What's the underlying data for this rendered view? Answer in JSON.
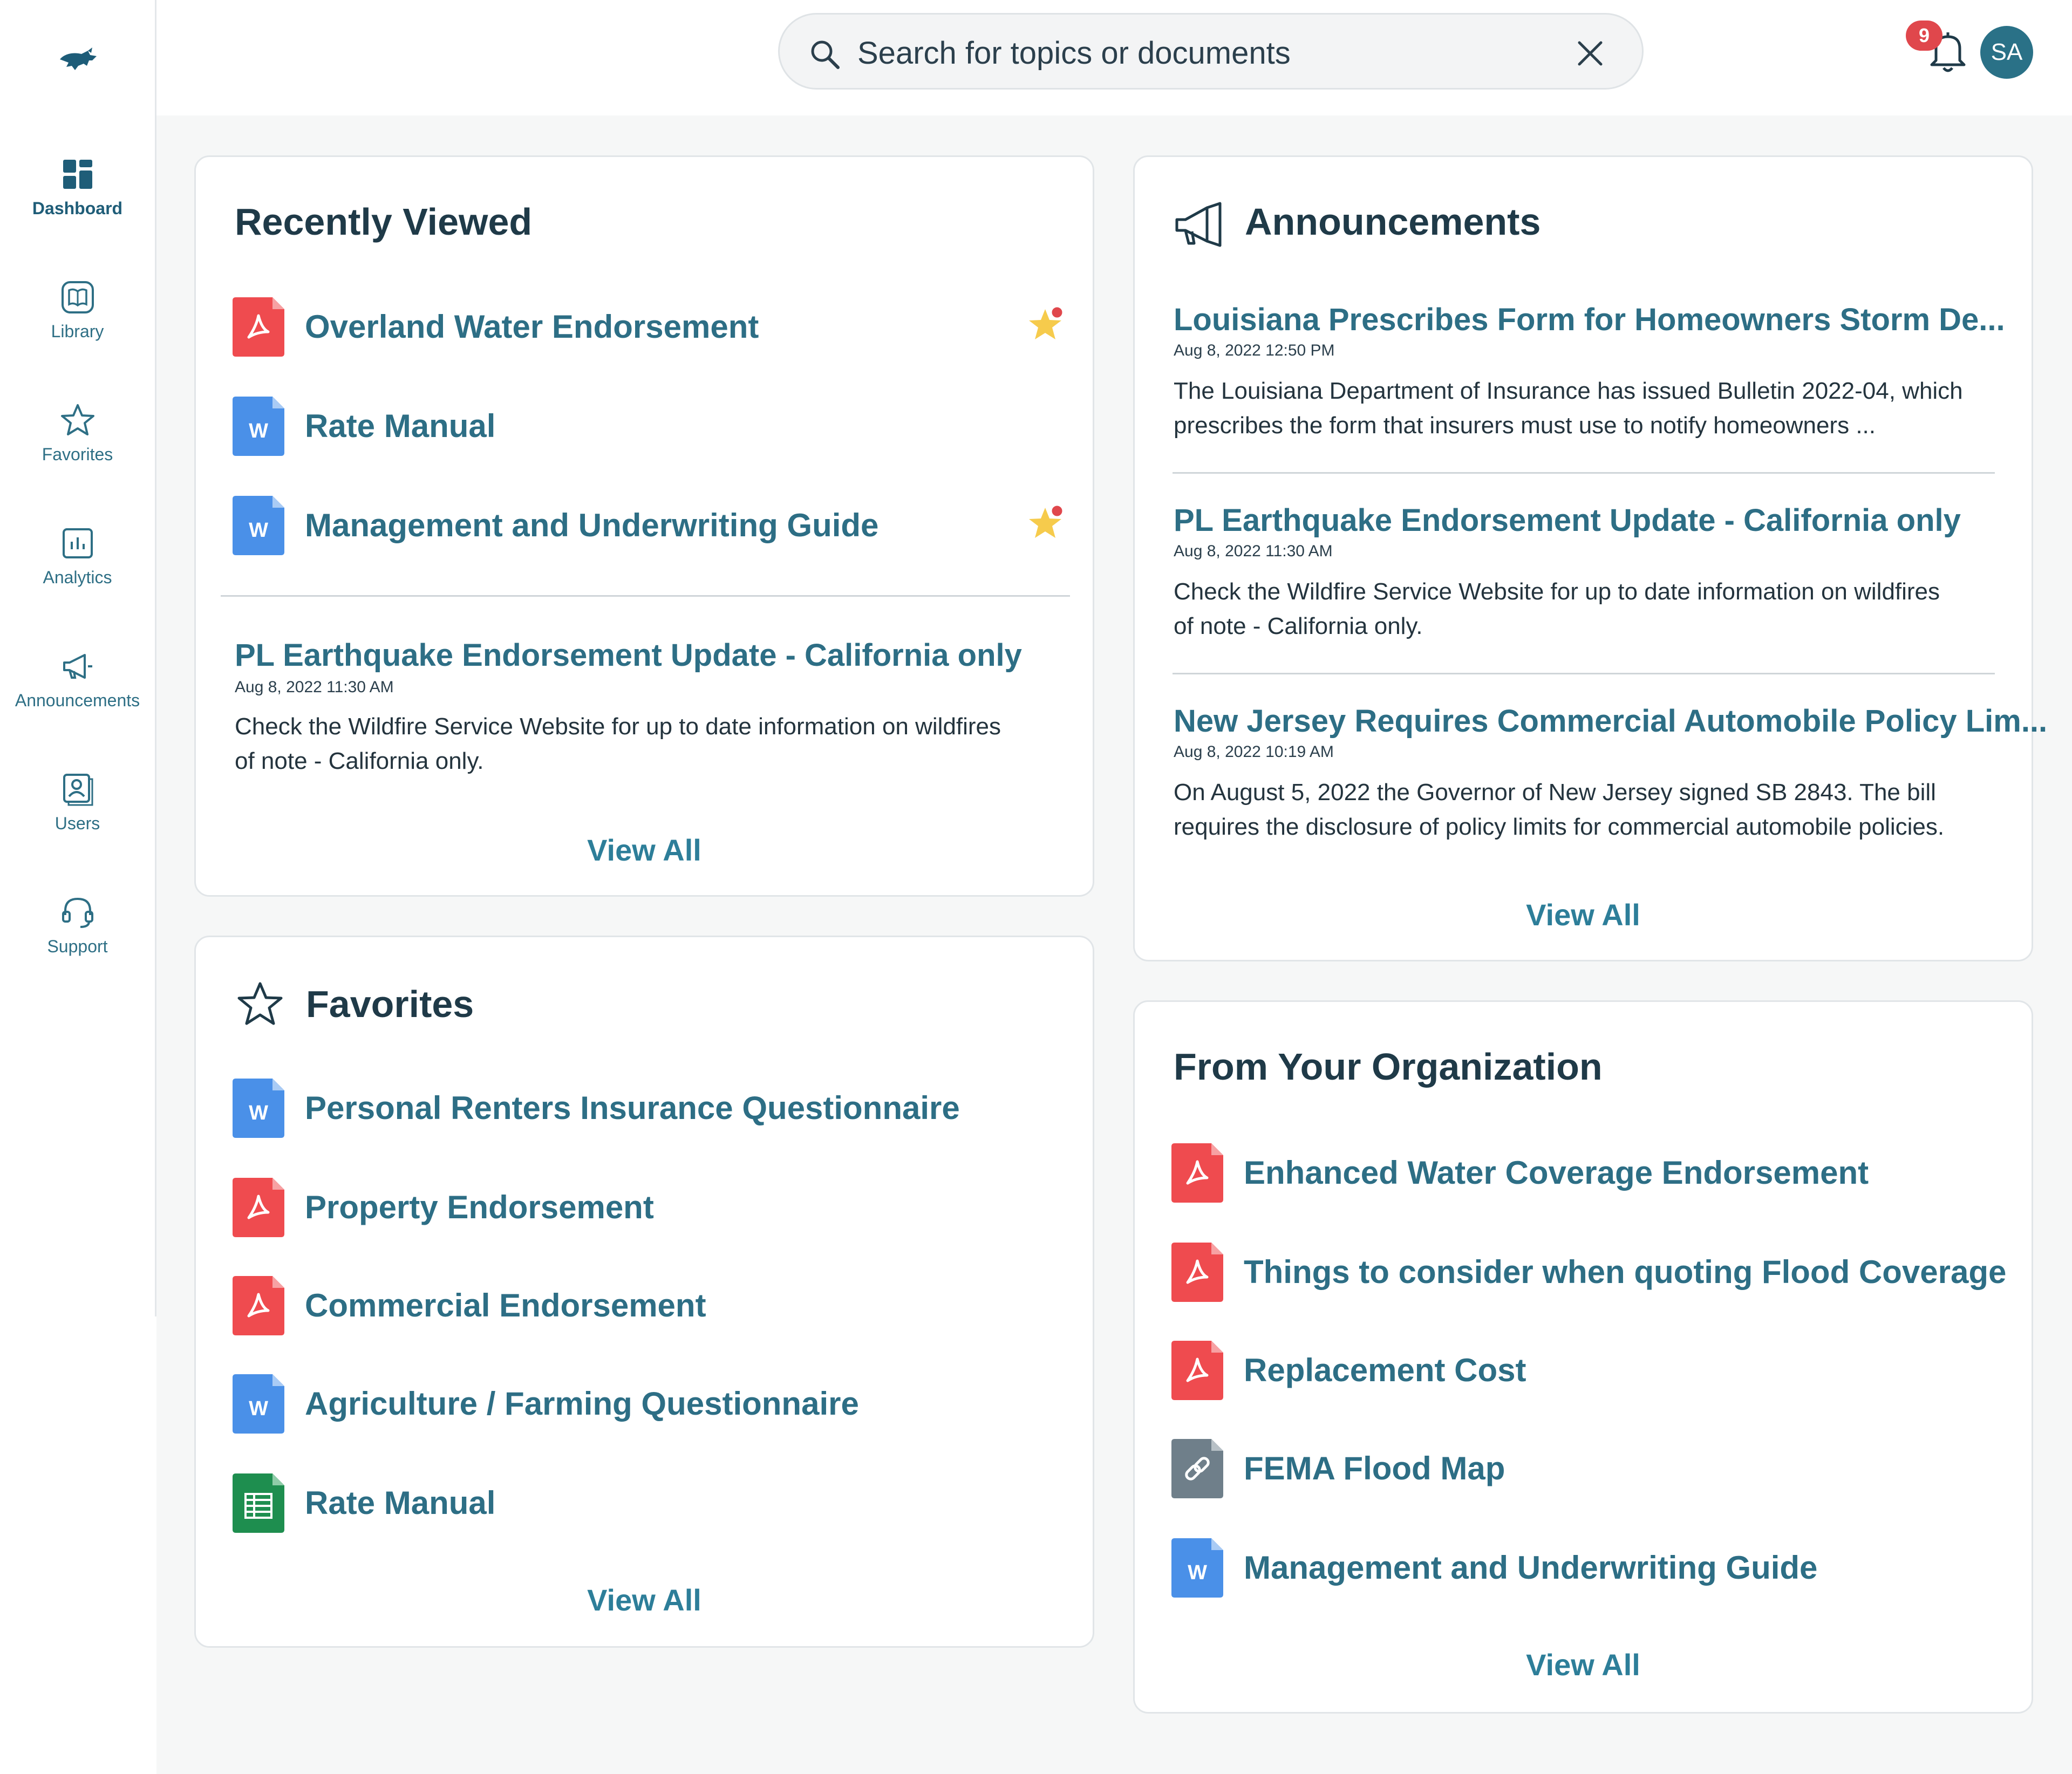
{
  "nav": {
    "items": [
      {
        "label": "Dashboard",
        "icon": "dashboard-icon",
        "active": true
      },
      {
        "label": "Library",
        "icon": "library-icon"
      },
      {
        "label": "Favorites",
        "icon": "star-icon"
      },
      {
        "label": "Analytics",
        "icon": "analytics-icon"
      },
      {
        "label": "Announcements",
        "icon": "megaphone-icon"
      },
      {
        "label": "Users",
        "icon": "users-icon"
      },
      {
        "label": "Support",
        "icon": "headset-icon"
      }
    ]
  },
  "search": {
    "placeholder": "Search for topics or documents"
  },
  "header": {
    "notifications_count": "9",
    "avatar_initials": "SA"
  },
  "recently_viewed": {
    "title": "Recently Viewed",
    "items": [
      {
        "label": "Overland Water Endorsement",
        "type": "pdf",
        "favorited": true
      },
      {
        "label": "Rate Manual",
        "type": "word",
        "favorited": false
      },
      {
        "label": "Management and Underwriting Guide",
        "type": "word",
        "favorited": true
      }
    ],
    "announcement": {
      "title": "PL Earthquake Endorsement Update - California only",
      "date": "Aug 8, 2022 11:30 AM",
      "body_line1": "Check the Wildfire Service Website for up to date information on wildfires",
      "body_line2": "of note - California only."
    },
    "view_all": "View All"
  },
  "favorites": {
    "title": "Favorites",
    "items": [
      {
        "label": "Personal Renters Insurance Questionnaire",
        "type": "word"
      },
      {
        "label": "Property Endorsement",
        "type": "pdf"
      },
      {
        "label": "Commercial Endorsement",
        "type": "pdf"
      },
      {
        "label": "Agriculture / Farming Questionnaire",
        "type": "word"
      },
      {
        "label": "Rate Manual",
        "type": "sheet"
      }
    ],
    "view_all": "View All"
  },
  "announcements": {
    "title": "Announcements",
    "items": [
      {
        "title": "Louisiana Prescribes Form for Homeowners Storm De...",
        "date": "Aug 8, 2022 12:50 PM",
        "body_line1": "The Louisiana Department of Insurance has issued Bulletin 2022-04, which",
        "body_line2": "prescribes the form that insurers must use to notify homeowners ..."
      },
      {
        "title": "PL Earthquake Endorsement Update - California only",
        "date": "Aug 8, 2022 11:30 AM",
        "body_line1": "Check the Wildfire Service Website for up to date information on wildfires",
        "body_line2": "of note - California only."
      },
      {
        "title": "New Jersey Requires Commercial Automobile Policy Lim...",
        "date": "Aug 8, 2022 10:19 AM",
        "body_line1": "On August 5, 2022 the Governor of New Jersey signed SB 2843. The bill",
        "body_line2": "requires the disclosure of policy limits for commercial automobile policies."
      }
    ],
    "view_all": "View All"
  },
  "organization": {
    "title": "From Your Organization",
    "items": [
      {
        "label": "Enhanced Water Coverage Endorsement",
        "type": "pdf"
      },
      {
        "label": "Things to consider when quoting Flood Coverage",
        "type": "pdf"
      },
      {
        "label": "Replacement Cost",
        "type": "pdf"
      },
      {
        "label": "FEMA Flood Map",
        "type": "link"
      },
      {
        "label": "Management and Underwriting Guide",
        "type": "word"
      }
    ],
    "view_all": "View All"
  },
  "colors": {
    "accent": "#2d6e85",
    "pdf": "#ef4b4f",
    "word": "#4a90e8",
    "sheet": "#1e8e4f",
    "link": "#6f7f8a",
    "badge": "#e0474c",
    "avatar": "#2a7187"
  }
}
